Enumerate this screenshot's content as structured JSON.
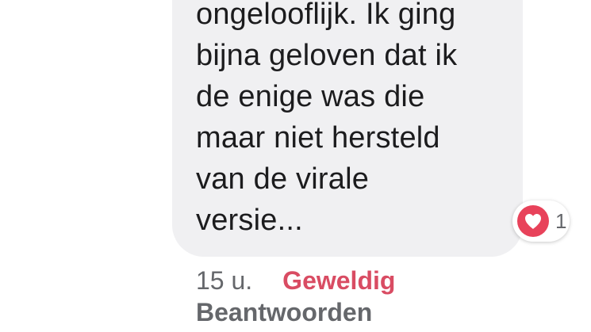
{
  "comment": {
    "lines": [
      "ongelooflijk. Ik ging",
      "bijna geloven dat ik",
      "de enige was die",
      "maar niet hersteld",
      "van de virale",
      "versie..."
    ],
    "reaction": {
      "icon": "heart-icon",
      "color": "#e8425a",
      "count": "1"
    }
  },
  "meta": {
    "time": "15 u.",
    "reaction_label": "Geweldig",
    "reply_label": "Beantwoorden"
  }
}
